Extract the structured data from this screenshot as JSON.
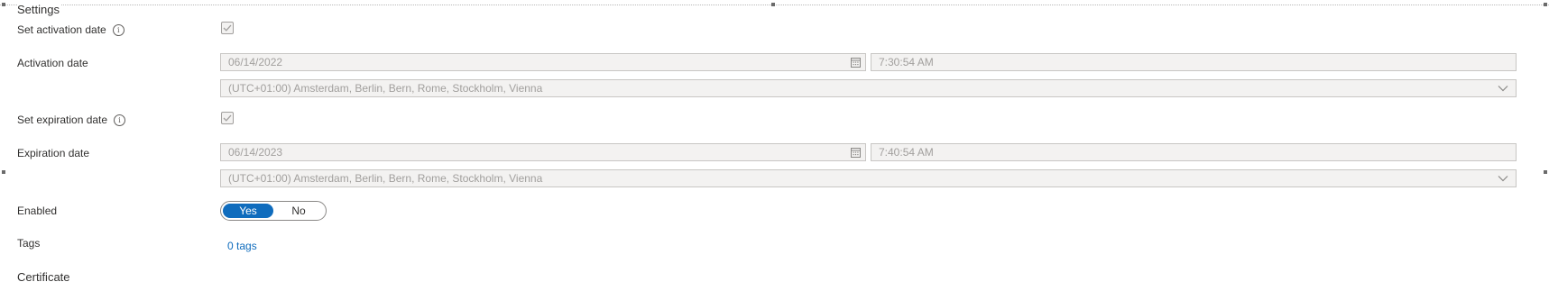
{
  "settings": {
    "title": "Settings"
  },
  "activation": {
    "set_label": "Set activation date",
    "checked": true,
    "date_label": "Activation date",
    "date_value": "06/14/2022",
    "time_value": "7:30:54 AM",
    "timezone_value": "(UTC+01:00) Amsterdam, Berlin, Bern, Rome, Stockholm, Vienna"
  },
  "expiration": {
    "set_label": "Set expiration date",
    "checked": true,
    "date_label": "Expiration date",
    "date_value": "06/14/2023",
    "time_value": "7:40:54 AM",
    "timezone_value": "(UTC+01:00) Amsterdam, Berlin, Bern, Rome, Stockholm, Vienna"
  },
  "enabled": {
    "label": "Enabled",
    "yes_label": "Yes",
    "no_label": "No",
    "selected": "Yes"
  },
  "tags": {
    "label": "Tags",
    "link_text": "0 tags"
  },
  "certificate": {
    "title": "Certificate"
  },
  "icons": {
    "info": "info-icon",
    "calendar": "calendar-icon",
    "chevron": "chevron-down-icon",
    "check": "checkmark-icon"
  },
  "colors": {
    "accent": "#0f6cbd",
    "disabled_text": "#a19f9d",
    "field_background": "#f3f2f1"
  }
}
